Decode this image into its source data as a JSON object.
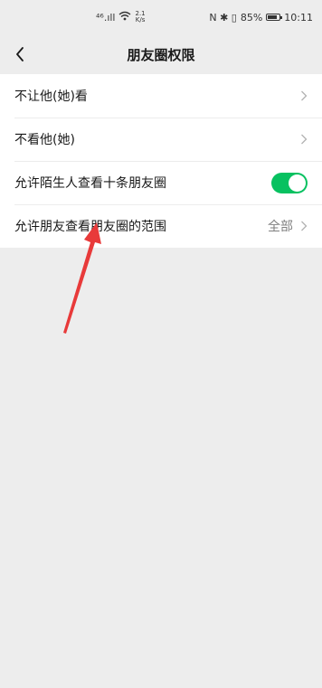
{
  "status_bar": {
    "signal": "⁴⁶.ıll",
    "net_speed_value": "2.1",
    "net_speed_unit": "K/s",
    "icons_right": "N ✱ ▯",
    "battery_percent": "85%",
    "battery_level": 0.85,
    "time": "10:11"
  },
  "header": {
    "title": "朋友圈权限"
  },
  "settings": {
    "items": [
      {
        "label": "不让他(她)看",
        "value": ""
      },
      {
        "label": "不看他(她)",
        "value": ""
      },
      {
        "label": "允许陌生人查看十条朋友圈",
        "toggle_on": true
      },
      {
        "label": "允许朋友查看朋友圈的范围",
        "value": "全部"
      }
    ]
  },
  "colors": {
    "accent_green": "#07c160",
    "annotation_red": "#e83a3a",
    "background": "#ededed"
  }
}
